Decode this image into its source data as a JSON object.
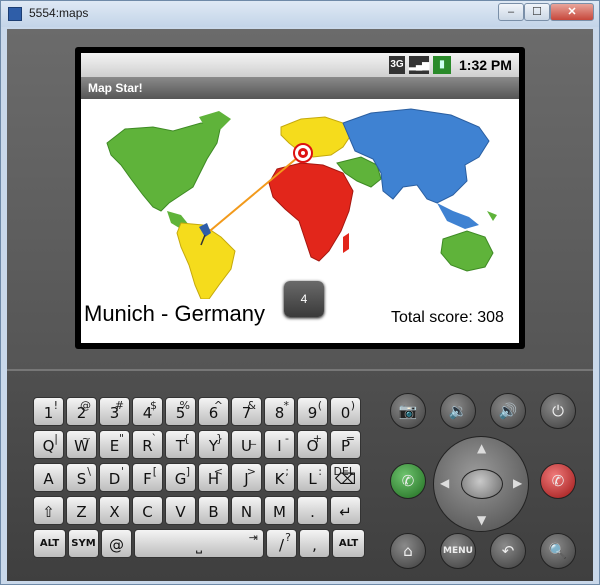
{
  "window": {
    "title": "5554:maps",
    "min": "–",
    "max": "☐",
    "close": "✕"
  },
  "status": {
    "net": "3G",
    "signal": "▂▄▆",
    "battery": "▮",
    "time": "1:32 PM"
  },
  "app": {
    "name": "Map Star!"
  },
  "game": {
    "city": "Munich - Germany",
    "toast": "4",
    "score": "Total score: 308"
  },
  "keyboard": {
    "rows": [
      [
        {
          "m": "1",
          "s": "!"
        },
        {
          "m": "2",
          "s": "@"
        },
        {
          "m": "3",
          "s": "#"
        },
        {
          "m": "4",
          "s": "$"
        },
        {
          "m": "5",
          "s": "%"
        },
        {
          "m": "6",
          "s": "^"
        },
        {
          "m": "7",
          "s": "&"
        },
        {
          "m": "8",
          "s": "*"
        },
        {
          "m": "9",
          "s": "("
        },
        {
          "m": "0",
          "s": ")"
        }
      ],
      [
        {
          "m": "Q",
          "s": "|"
        },
        {
          "m": "W",
          "s": "~"
        },
        {
          "m": "E",
          "s": "\""
        },
        {
          "m": "R",
          "s": "`"
        },
        {
          "m": "T",
          "s": "{"
        },
        {
          "m": "Y",
          "s": "}"
        },
        {
          "m": "U",
          "s": "_"
        },
        {
          "m": "I",
          "s": "-"
        },
        {
          "m": "O",
          "s": "+"
        },
        {
          "m": "P",
          "s": "="
        }
      ],
      [
        {
          "m": "A",
          "s": ""
        },
        {
          "m": "S",
          "s": "\\"
        },
        {
          "m": "D",
          "s": "'"
        },
        {
          "m": "F",
          "s": "["
        },
        {
          "m": "G",
          "s": "]"
        },
        {
          "m": "H",
          "s": "<"
        },
        {
          "m": "J",
          "s": ">"
        },
        {
          "m": "K",
          "s": ";"
        },
        {
          "m": "L",
          "s": ":"
        },
        {
          "m": "⌫",
          "s": "DEL"
        }
      ],
      [
        {
          "m": "⇧",
          "s": ""
        },
        {
          "m": "Z",
          "s": ""
        },
        {
          "m": "X",
          "s": ""
        },
        {
          "m": "C",
          "s": ""
        },
        {
          "m": "V",
          "s": ""
        },
        {
          "m": "B",
          "s": ""
        },
        {
          "m": "N",
          "s": ""
        },
        {
          "m": "M",
          "s": ""
        },
        {
          "m": ".",
          "s": ""
        },
        {
          "m": "↵",
          "s": ""
        }
      ]
    ],
    "bottom": {
      "alt": "ALT",
      "sym": "SYM",
      "at": "@",
      "space": "⎵",
      "tab": "⇥",
      "slash": "/",
      "question": "?",
      "comma": ",",
      "alt2": "ALT"
    }
  },
  "hw": {
    "camera": "📷",
    "vol_down": "🔉",
    "vol_up": "🔊",
    "power": "⏻",
    "call": "✆",
    "end": "✆",
    "home": "⌂",
    "menu": "MENU",
    "back": "↶",
    "search": "🔍"
  },
  "colors": {
    "green": "#5fb33a",
    "yellow": "#f5dc1c",
    "red": "#e2261b",
    "blue": "#3f82d2"
  }
}
